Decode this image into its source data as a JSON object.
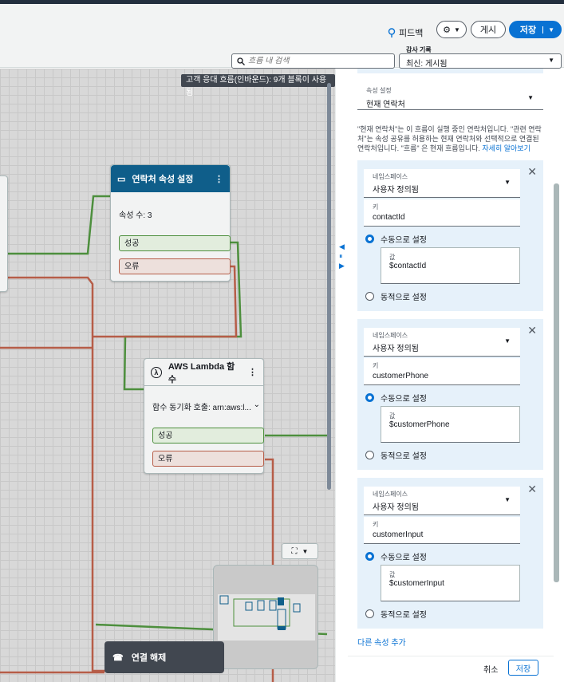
{
  "header": {
    "feedback": "피드백",
    "publish": "게시",
    "save": "저장",
    "search_placeholder": "흐름 내 검색",
    "audit_label": "감사 기록",
    "audit_value": "최신: 게시됨"
  },
  "canvas": {
    "banner": "고객 응대 흐름(인바운드): 9개 블록이 사용됨",
    "set_attr_block": {
      "title": "연락처 속성 설정",
      "attr_count": "속성 수: 3",
      "success": "성공",
      "error": "오류"
    },
    "lambda_block": {
      "title": "AWS Lambda 함수",
      "invoke": "함수 동기화 호출: arn:aws:l...",
      "success": "성공",
      "error": "오류"
    },
    "disconnect": "연결 해제"
  },
  "panel": {
    "attr_setting_label": "속성 설정",
    "attr_setting_value": "현재 연락처",
    "description": "\"현재 연락처\"는 이 흐름이 실행 중인 연락처입니다. \"관련 연락처\"는 속성 공유를 허용하는 현재 연락처와 선택적으로 연결된 연락처입니다. \"흐름\" 은 현재 흐름입니다.",
    "learn_more": "자세히 알아보기",
    "namespace_label": "네임스페이스",
    "namespace_value": "사용자 정의됨",
    "key_label": "키",
    "value_label": "값",
    "manual": "수동으로 설정",
    "dynamic": "동적으로 설정",
    "attributes": [
      {
        "key": "contactId",
        "value": "$contactId"
      },
      {
        "key": "customerPhone",
        "value": "$customerPhone"
      },
      {
        "key": "customerInput",
        "value": "$customerInput"
      }
    ],
    "add_attr": "다른 속성 추가",
    "cancel": "취소",
    "save": "저장"
  },
  "colors": {
    "accent": "#0972d3",
    "block_header": "#0f5e8a",
    "success_line": "#4d8f3d",
    "error_line": "#b65d48"
  }
}
